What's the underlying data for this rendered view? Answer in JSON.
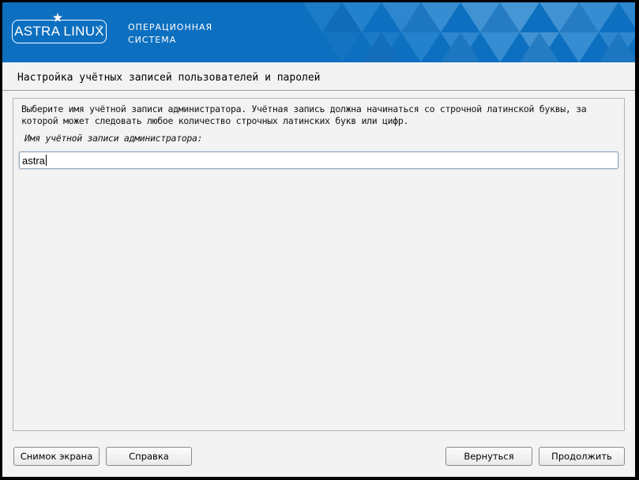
{
  "header": {
    "logo_text": "ASTRA LINUX",
    "logo_reg_mark": "®",
    "subtitle_line1": "ОПЕРАЦИОННАЯ",
    "subtitle_line2": "СИСТЕМА",
    "brand_color": "#0d6fbf"
  },
  "page": {
    "title": "Настройка учётных записей пользователей и паролей"
  },
  "content": {
    "description_line1": "Выберите имя учётной записи администратора. Учётная запись должна начинаться со строчной латинской буквы, за",
    "description_line2": "которой может следовать любое количество строчных латинских букв или цифр.",
    "field_label": "Имя учётной записи администратора:",
    "field_value": "astra"
  },
  "buttons": {
    "screenshot": "Снимок экрана",
    "help": "Справка",
    "back": "Вернуться",
    "continue": "Продолжить"
  }
}
